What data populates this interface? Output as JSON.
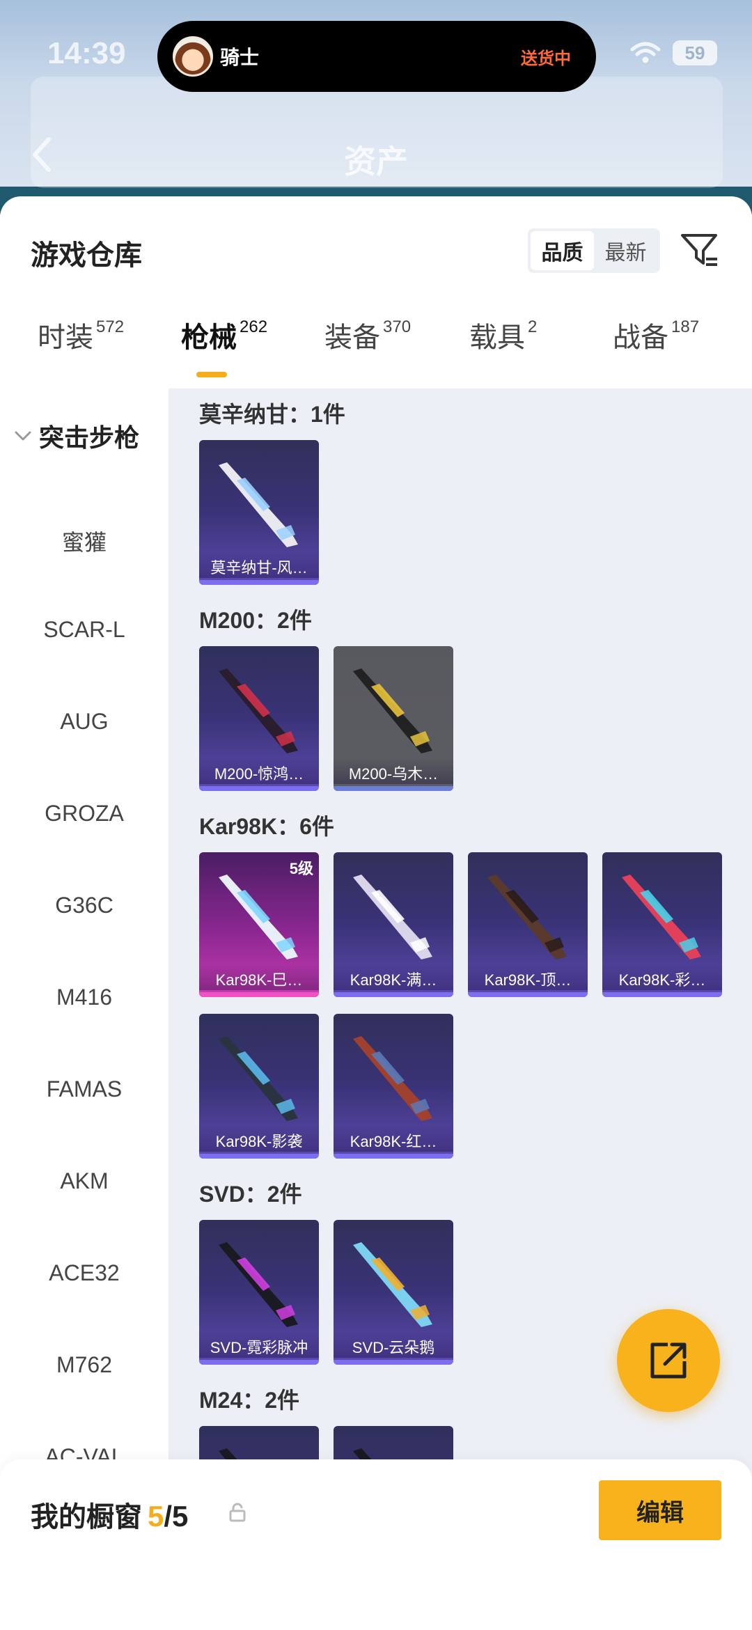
{
  "status": {
    "time": "14:39",
    "battery": "59"
  },
  "island": {
    "name": "骑士",
    "status": "送货中"
  },
  "header": {
    "bg_title": "资产"
  },
  "page": {
    "title": "游戏仓库",
    "sort": [
      {
        "label": "品质",
        "active": true
      },
      {
        "label": "最新",
        "active": false
      }
    ]
  },
  "tabs": [
    {
      "label": "时装",
      "count": "572",
      "active": false
    },
    {
      "label": "枪械",
      "count": "262",
      "active": true
    },
    {
      "label": "装备",
      "count": "370",
      "active": false
    },
    {
      "label": "载具",
      "count": "2",
      "active": false
    },
    {
      "label": "战备",
      "count": "187",
      "active": false
    }
  ],
  "sidebar": {
    "category": "突击步枪",
    "items": [
      "蜜獾",
      "SCAR-L",
      "AUG",
      "GROZA",
      "G36C",
      "M416",
      "FAMAS",
      "AKM",
      "ACE32",
      "M762",
      "AC-VAL"
    ]
  },
  "groups": [
    {
      "title": "莫辛纳甘：1件",
      "items": [
        {
          "name": "莫辛纳甘-风…",
          "style": "purple",
          "gun": "#e8e8ee",
          "accent": "#9ad0ff"
        }
      ]
    },
    {
      "title": "M200：2件",
      "items": [
        {
          "name": "M200-惊鸿…",
          "style": "purple",
          "gun": "#2a1e2e",
          "accent": "#d0304a"
        },
        {
          "name": "M200-乌木…",
          "style": "grey",
          "gun": "#222222",
          "accent": "#e8c23a"
        }
      ]
    },
    {
      "title": "Kar98K：6件",
      "items": [
        {
          "name": "Kar98K-巳…",
          "style": "pink",
          "gun": "#e8eef8",
          "accent": "#7fd4ff",
          "level": "5级"
        },
        {
          "name": "Kar98K-满…",
          "style": "purple",
          "gun": "#d9d4ea",
          "accent": "#ffffff"
        },
        {
          "name": "Kar98K-顶…",
          "style": "purple",
          "gun": "#5a3a2e",
          "accent": "#2a1c18"
        },
        {
          "name": "Kar98K-彩…",
          "style": "purple",
          "gun": "#e0405a",
          "accent": "#4ad0e8"
        },
        {
          "name": "Kar98K-影袭",
          "style": "purple",
          "gun": "#2a3440",
          "accent": "#5ab8e8"
        },
        {
          "name": "Kar98K-红…",
          "style": "purple",
          "gun": "#a0402e",
          "accent": "#5a7ab8"
        }
      ]
    },
    {
      "title": "SVD：2件",
      "items": [
        {
          "name": "SVD-霓彩脉冲",
          "style": "purple",
          "gun": "#1a1a22",
          "accent": "#d040e0"
        },
        {
          "name": "SVD-云朵鹅",
          "style": "purple",
          "gun": "#7ad0ee",
          "accent": "#f0b030"
        }
      ]
    },
    {
      "title": "M24：2件",
      "items": [
        {
          "name": "",
          "style": "purple",
          "gun": "#1a1a22",
          "accent": "#888888"
        },
        {
          "name": "",
          "style": "purple",
          "gun": "#1a1a22",
          "accent": "#888888"
        }
      ]
    }
  ],
  "bottom": {
    "label": "我的橱窗",
    "current": "5",
    "total": "/5",
    "edit": "编辑"
  },
  "colors": {
    "accent": "#f7b21c",
    "tab_underline": "#f5ad1b",
    "island_status": "#ff6a3d"
  }
}
